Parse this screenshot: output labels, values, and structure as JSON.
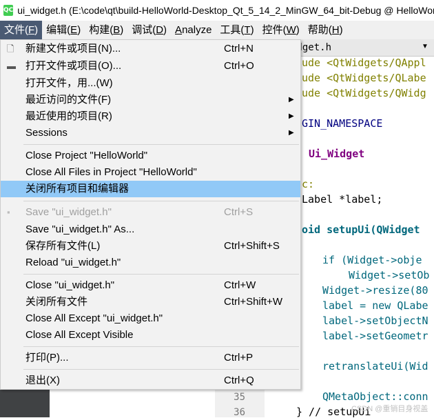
{
  "window": {
    "icon_text": "QC",
    "title": "ui_widget.h (E:\\code\\qt\\build-HelloWorld-Desktop_Qt_5_14_2_MinGW_64_bit-Debug @ HelloWorld"
  },
  "menubar": [
    {
      "pre": "文件(",
      "mn": "F",
      "post": ")"
    },
    {
      "pre": "编辑(",
      "mn": "E",
      "post": ")"
    },
    {
      "pre": "构建(",
      "mn": "B",
      "post": ")"
    },
    {
      "pre": "调试(",
      "mn": "D",
      "post": ")"
    },
    {
      "pre": "",
      "mn": "A",
      "post": "nalyze"
    },
    {
      "pre": "工具(",
      "mn": "T",
      "post": ")"
    },
    {
      "pre": "控件(",
      "mn": "W",
      "post": ")"
    },
    {
      "pre": "帮助(",
      "mn": "H",
      "post": ")"
    }
  ],
  "file_menu": {
    "new": {
      "label": "新建文件或项目(N)...",
      "shortcut": "Ctrl+N"
    },
    "open": {
      "label": "打开文件或项目(O)...",
      "shortcut": "Ctrl+O"
    },
    "open_with": {
      "label": "打开文件，用...(W)"
    },
    "recent_files": {
      "label": "最近访问的文件(F)"
    },
    "recent_projects": {
      "label": "最近使用的项目(R)"
    },
    "sessions": {
      "label": "Sessions"
    },
    "close_project": {
      "label": "Close Project \"HelloWorld\""
    },
    "close_all_files_project": {
      "label": "Close All Files in Project \"HelloWorld\""
    },
    "close_all_projects_editors": {
      "label": "关闭所有项目和编辑器"
    },
    "save": {
      "label": "Save \"ui_widget.h\"",
      "shortcut": "Ctrl+S"
    },
    "save_as": {
      "label": "Save \"ui_widget.h\" As..."
    },
    "save_all": {
      "label": "保存所有文件(L)",
      "shortcut": "Ctrl+Shift+S"
    },
    "reload": {
      "label": "Reload \"ui_widget.h\""
    },
    "close": {
      "label": "Close \"ui_widget.h\"",
      "shortcut": "Ctrl+W"
    },
    "close_all": {
      "label": "关闭所有文件",
      "shortcut": "Ctrl+Shift+W"
    },
    "close_all_except": {
      "label": "Close All Except \"ui_widget.h\""
    },
    "close_all_except_visible": {
      "label": "Close All Except Visible"
    },
    "print": {
      "label": "打印(P)...",
      "shortcut": "Ctrl+P"
    },
    "exit": {
      "label": "退出(X)",
      "shortcut": "Ctrl+Q"
    }
  },
  "editor": {
    "tab_label": "idget.h",
    "line_numbers": [
      "35",
      "36"
    ],
    "code_lines": [
      "ude <QtWidgets/QAppl",
      "ude <QtWidgets/QLabe",
      "ude <QtWidgets/QWidg",
      "GIN_NAMESPACE",
      "Ui_Widget",
      "c:",
      "Label *label;",
      "oid setupUi(QWidget",
      "if (Widget->obje",
      "Widget->setOb",
      "Widget->resize(80",
      "label = new QLabe",
      "label->setObjectN",
      "label->setGeometr",
      "retranslateUi(Wid",
      "QMetaObject::conn",
      "} // setupUi"
    ]
  },
  "watermark": "CSDN @重销目身视盖"
}
